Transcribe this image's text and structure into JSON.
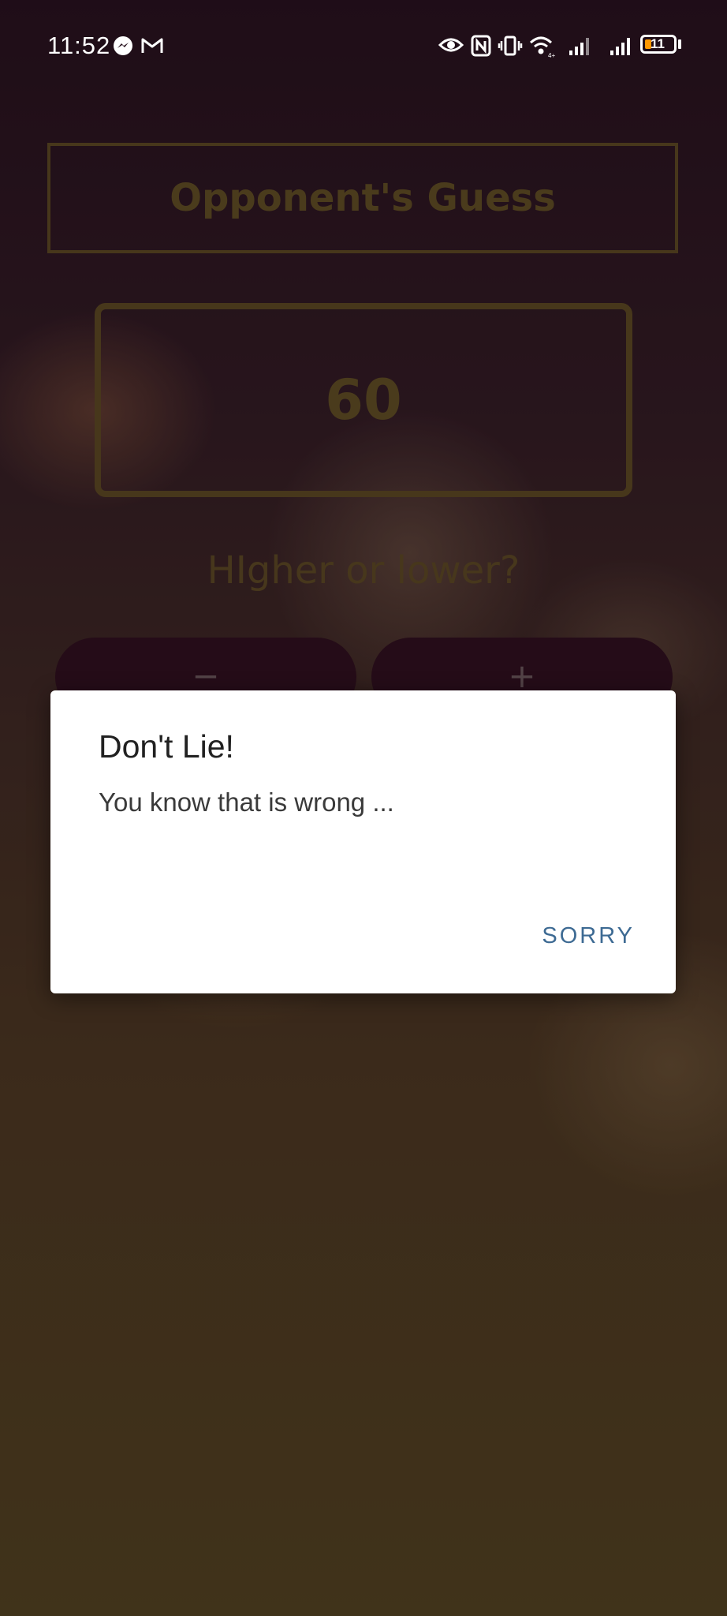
{
  "status_bar": {
    "time": "11:52",
    "battery_level": "11",
    "icons": [
      "messenger-icon",
      "gmail-icon",
      "eye-icon",
      "nfc-icon",
      "vibrate-icon",
      "wifi-icon",
      "signal-icon",
      "signal-icon",
      "battery-icon"
    ]
  },
  "game": {
    "title": "Opponent's Guess",
    "guess_number": "60",
    "prompt": "HIgher or lower?",
    "minus_label": "−",
    "plus_label": "+"
  },
  "dialog": {
    "title": "Don't Lie!",
    "message": "You know that is wrong ...",
    "button_label": "SORRY"
  },
  "colors": {
    "accent_gold": "#5f4f22",
    "button_dark": "#2b0f1c",
    "dialog_button": "#3d6a93"
  }
}
